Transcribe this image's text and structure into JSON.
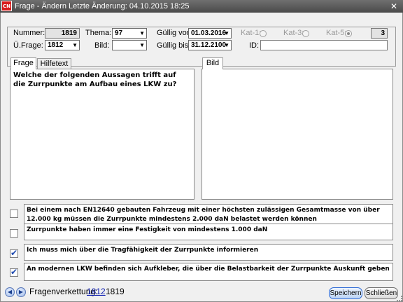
{
  "window": {
    "title": "Frage - Ändern   Letzte Änderung: 04.10.2015 18:25",
    "app_icon_text": "CN",
    "close_glyph": "✕"
  },
  "header": {
    "nummer_label": "Nummer:",
    "nummer_value": "1819",
    "thema_label": "Thema:",
    "thema_value": "97",
    "gueltig_von_label": "Güllig von:",
    "gueltig_von_value": "01.03.2016",
    "kat1_label": "Kat-1:",
    "kat3_label": "Kat-3:",
    "kat5_label": "Kat-5:",
    "kat_count": "3",
    "ufrage_label": "Ü.Frage:",
    "ufrage_value": "1812",
    "bild_label": "Bild:",
    "bild_value": "",
    "gueltig_bis_label": "Güllig bis:",
    "gueltig_bis_value": "31.12.2100",
    "id_label": "ID:",
    "id_value": ""
  },
  "tabs": {
    "frage": "Frage",
    "hilfetext": "Hilfetext",
    "bild": "Bild"
  },
  "question": {
    "text": "Welche der folgenden Aussagen trifft auf die Zurrpunkte am Aufbau eines LKW zu?"
  },
  "answers": [
    {
      "text": "Bei einem nach EN12640 gebauten Fahrzeug mit einer höchsten zulässigen Gesamtmasse von über 12.000 kg müssen die Zurrpunkte mindestens 2.000 daN belastet werden können",
      "checked": false
    },
    {
      "text": "Zurrpunkte haben immer eine Festigkeit von mindestens 1.000 daN",
      "checked": false
    },
    {
      "text": "Ich muss mich über die Tragfähigkeit der Zurrpunkte informieren",
      "checked": true
    },
    {
      "text": "An modernen LKW befinden sich Aufkleber, die über die Belastbarkeit der Zurrpunkte Auskunft geben",
      "checked": true
    }
  ],
  "footer": {
    "prev_glyph": "◀",
    "next_glyph": "▶",
    "chain_label": "Fragenverkettung:",
    "chain_link": "1812",
    "chain_value": "1819",
    "save_label": "Speichern",
    "close_label": "Schließen"
  }
}
